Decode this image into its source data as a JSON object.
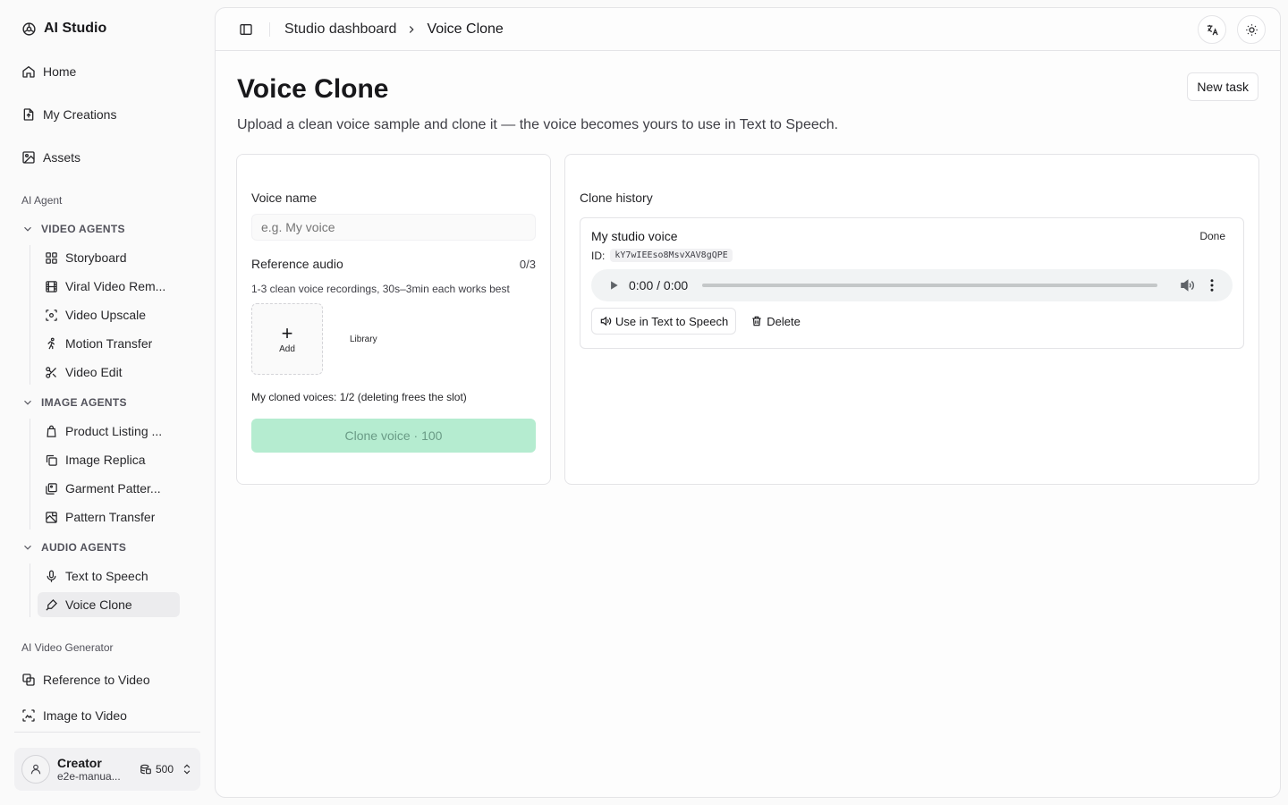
{
  "app": {
    "name": "AI Studio"
  },
  "sidebar": {
    "main": [
      {
        "label": "Home",
        "icon": "home-icon"
      },
      {
        "label": "My Creations",
        "icon": "file-icon"
      },
      {
        "label": "Assets",
        "icon": "image-icon"
      }
    ],
    "section_agent": "AI Agent",
    "groups": [
      {
        "title": "VIDEO AGENTS",
        "items": [
          "Storyboard",
          "Viral Video Rem...",
          "Video Upscale",
          "Motion Transfer",
          "Video Edit"
        ]
      },
      {
        "title": "IMAGE AGENTS",
        "items": [
          "Product Listing ...",
          "Image Replica",
          "Garment Patter...",
          "Pattern Transfer"
        ]
      },
      {
        "title": "AUDIO AGENTS",
        "items": [
          "Text to Speech",
          "Voice Clone"
        ]
      }
    ],
    "active_item": "Voice Clone",
    "section_video": "AI Video Generator",
    "video_items": [
      {
        "label": "Reference to Video",
        "icon": "layers-icon"
      },
      {
        "label": "Image to Video",
        "icon": "image-scan-icon"
      }
    ],
    "user": {
      "name": "Creator",
      "email": "e2e-manua...",
      "credits": "500"
    }
  },
  "topbar": {
    "breadcrumb_root": "Studio dashboard",
    "breadcrumb_current": "Voice Clone"
  },
  "page": {
    "title": "Voice Clone",
    "description": "Upload a clean voice sample and clone it — the voice becomes yours to use in Text to Speech.",
    "new_task": "New task"
  },
  "form": {
    "voice_name_label": "Voice name",
    "voice_name_placeholder": "e.g. My voice",
    "reference_label": "Reference audio",
    "reference_count": "0/3",
    "hint": "1-3 clean voice recordings, 30s–3min each works best",
    "add_label": "Add",
    "library_label": "Library",
    "quota": "My cloned voices: 1/2 (deleting frees the slot)",
    "clone_button": "Clone voice · 100"
  },
  "history": {
    "title": "Clone history",
    "items": [
      {
        "name": "My studio voice",
        "status": "Done",
        "id_label": "ID:",
        "id": "kY7wIEEso8MsvXAV8gQPE",
        "time": "0:00 / 0:00",
        "use_button": "Use in Text to Speech",
        "delete_button": "Delete"
      }
    ]
  },
  "colors": {
    "accent_disabled": "#b5ecd0",
    "active_bg": "#ececee"
  }
}
